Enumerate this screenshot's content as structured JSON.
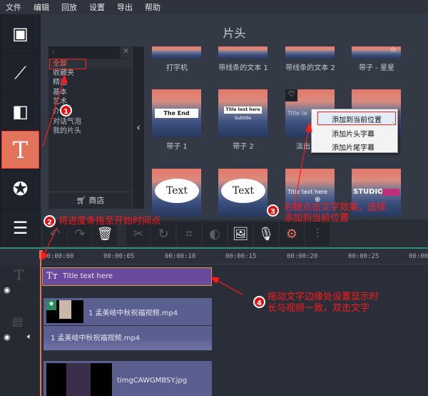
{
  "menu": [
    "文件",
    "编辑",
    "回放",
    "设置",
    "导出",
    "帮助"
  ],
  "panel_title": "片头",
  "categories": [
    "全部",
    "收藏夹",
    "精选",
    "基本",
    "艺术",
    "介绍",
    "对话气泡",
    "我的片头"
  ],
  "store_label": "商店",
  "tiles": [
    {
      "label": "打字机"
    },
    {
      "label": "带线条的文本 1"
    },
    {
      "label": "带线条的文本 2"
    },
    {
      "label": "带子 - 星星"
    },
    {
      "label": "带子 1",
      "text": "The End"
    },
    {
      "label": "带子 2",
      "text": "Title text here",
      "sub": "Subtitle"
    },
    {
      "label": "淡出",
      "text": "Title te"
    },
    {
      "label": ""
    },
    {
      "text": "Text"
    },
    {
      "text": "Text"
    },
    {
      "text": "Title text here"
    },
    {
      "text": "STUDIO"
    }
  ],
  "context_menu": [
    "添加到当前位置",
    "添加片头字幕",
    "添加片尾字幕"
  ],
  "ruler": [
    "00:00:00",
    "00:00:05",
    "00:00:10",
    "00:00:15",
    "00:00:20",
    "00:00:25",
    "00:00:30"
  ],
  "clips": {
    "title": "Title text here",
    "video": "1 孟美岐中秋祝福视频.mp4",
    "audio": "1 孟美岐中秋祝福视频.mp4",
    "image": "timgCAWGMBSY.jpg"
  },
  "annotations": {
    "n1": "1",
    "n2": "2",
    "n3": "3",
    "n4": "4",
    "a2": "将进度条拖至开始时间点",
    "a3a": "右键点击文字效果，选择",
    "a3b": "添加到当前位置",
    "a4a": "拖动文字边缘处设置显示时",
    "a4b": "长与视频一致，双击文字"
  },
  "colors": {
    "accent": "#e2745c",
    "title_clip": "#6a4a9c",
    "annotation": "#ff1a1a"
  }
}
